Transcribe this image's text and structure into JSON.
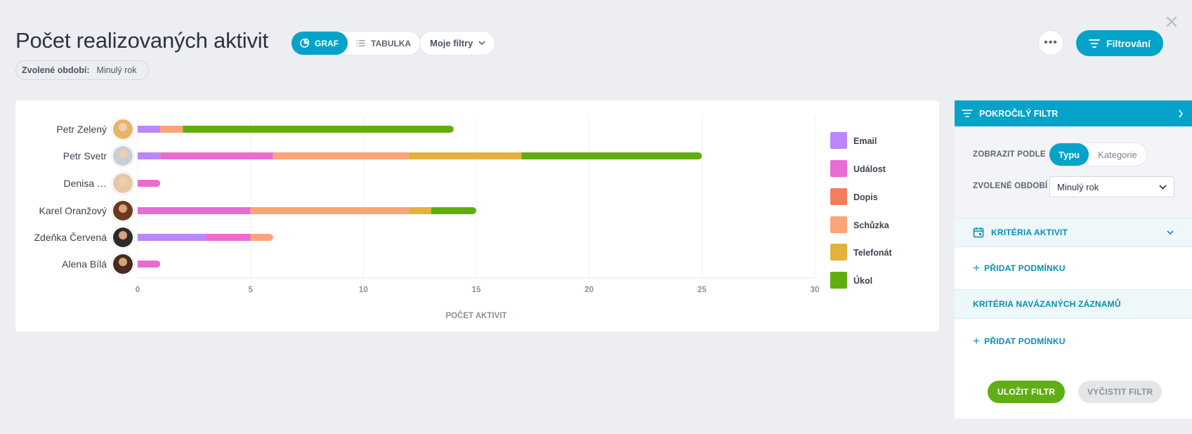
{
  "page": {
    "title": "Počet realizovaných aktivit"
  },
  "view_toggle": {
    "graph_label": "GRAF",
    "table_label": "TABULKA"
  },
  "my_filters_label": "Moje filtry",
  "period_chip": {
    "label": "Zvolené období:",
    "value": "Minulý rok"
  },
  "more_label": "•••",
  "filter_button_label": "Filtrování",
  "close_label": "×",
  "colors": {
    "accent": "#05a3c9",
    "Email": "#bb86f7",
    "Událost": "#ea6bd1",
    "Dopis": "#f37e5e",
    "Schůzka": "#fba477",
    "Telefonát": "#e3b23b",
    "Úkol": "#62ad0e"
  },
  "chart_data": {
    "type": "bar",
    "orientation": "horizontal",
    "stacked": true,
    "categories": [
      "Petr Zelený",
      "Petr Svetr",
      "Denisa …",
      "Karel Oranžový",
      "Zdeňka Červená",
      "Alena Bílá"
    ],
    "series": [
      {
        "name": "Email",
        "values": [
          1,
          1,
          0,
          0,
          3,
          0
        ]
      },
      {
        "name": "Událost",
        "values": [
          0,
          5,
          1,
          5,
          2,
          1
        ]
      },
      {
        "name": "Dopis",
        "values": [
          0,
          0,
          0,
          0,
          0,
          0
        ]
      },
      {
        "name": "Schůzka",
        "values": [
          1,
          6,
          0,
          7,
          1,
          0
        ]
      },
      {
        "name": "Telefonát",
        "values": [
          0,
          5,
          0,
          1,
          0,
          0
        ]
      },
      {
        "name": "Úkol",
        "values": [
          12,
          8,
          0,
          2,
          0,
          0
        ]
      }
    ],
    "xlabel": "POČET AKTIVIT",
    "xlim": [
      0,
      30
    ],
    "xticks": [
      0,
      5,
      10,
      15,
      20,
      25,
      30
    ],
    "grid": true,
    "legend": "right"
  },
  "side_panel": {
    "header": "POKROČILÝ FILTR",
    "show_by_label": "ZOBRAZIT PODLE",
    "show_by_options": [
      "Typu",
      "Kategorie"
    ],
    "period_label": "ZVOLENÉ OBDOBÍ",
    "period_value": "Minulý rok",
    "activity_criteria": "KRITÉRIA AKTIVIT",
    "add_condition_1": "PŘIDAT PODMÍNKU",
    "linked_criteria": "KRITÉRIA NAVÁZANÝCH ZÁZNAMŮ",
    "add_condition_2": "PŘIDAT PODMÍNKU",
    "save": "ULOŽIT FILTR",
    "clear": "VYČISTIT FILTR"
  }
}
